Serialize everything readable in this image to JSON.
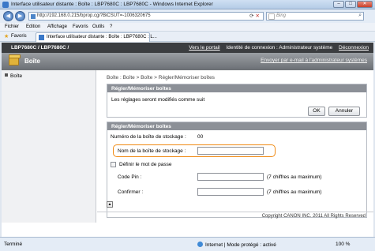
{
  "window": {
    "title": "Interface utilisateur distante : Boîte : LBP7680C : LBP7680C - Windows Internet Explorer",
    "controls": [
      "–",
      "□",
      "✕"
    ]
  },
  "address_bar": {
    "url": "http://192.168.0.215/bprop.cgi?BiCSUT=-1006320675",
    "search_placeholder": "Bing"
  },
  "menu": [
    "Fichier",
    "Edition",
    "Affichage",
    "Favoris",
    "Outils",
    "?"
  ],
  "favorites": {
    "label": "Favoris",
    "tab_title": "Interface utilisateur distante : Boîte : LBP7680C : L..."
  },
  "printer_bar": {
    "model": "LBP7680C / LBP7680C /",
    "portal_link": "Vers le portail",
    "login_info": "Identité de connexion : Administrateur système",
    "logout": "Déconnexion"
  },
  "header": {
    "title": "Boîte",
    "email_link": "Envoyer par e-mail à l'administrateur systèmes"
  },
  "sidebar": {
    "items": [
      {
        "label": "Boîte"
      }
    ]
  },
  "breadcrumb": "Boîte : Boîte > Boîte > Régler/Mémoriser boîtes",
  "confirm_panel": {
    "title": "Régler/Mémoriser boîtes",
    "message": "Les réglages seront modifiés comme suit",
    "ok_label": "OK",
    "cancel_label": "Annuler"
  },
  "form_panel": {
    "title": "Régler/Mémoriser boîtes",
    "box_number_label": "Numéro de la boîte de stockage :",
    "box_number_value": "00",
    "box_name_label": "Nom de la boîte de stockage :",
    "box_name_value": "",
    "set_password_label": "Définir le mot de passe",
    "set_password_checked": false,
    "pin_label": "Code Pin :",
    "pin_hint": "(7 chiffres au maximum)",
    "confirm_label": "Confirmer :",
    "confirm_hint": "(7 chiffres au maximum)"
  },
  "top_button": "▲",
  "footer": {
    "copyright": "Copyright CANON INC. 2011 All Rights Reserved"
  },
  "status_bar": {
    "status": "Terminé",
    "zone": "Internet | Mode protégé : activé",
    "zoom": "100 %"
  },
  "colors": {
    "printer_bar": "#3b3d40",
    "highlight": "#f08a14"
  }
}
